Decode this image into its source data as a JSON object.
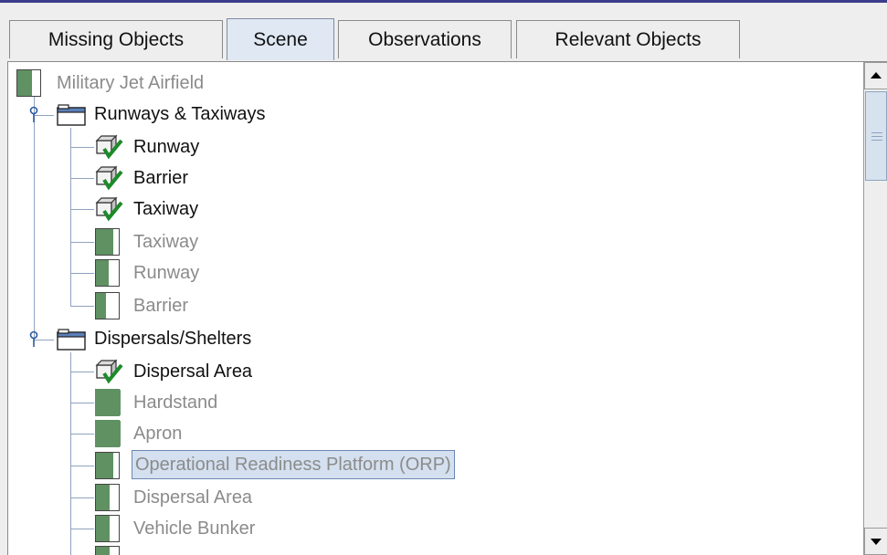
{
  "tabs": [
    {
      "label": "Missing Objects",
      "selected": false
    },
    {
      "label": "Scene",
      "selected": true
    },
    {
      "label": "Observations",
      "selected": false
    },
    {
      "label": "Relevant Objects",
      "selected": false
    }
  ],
  "tree": {
    "root": {
      "label": "Military Jet Airfield",
      "icon": "status-box-icon",
      "fill": 0.6
    },
    "groups": [
      {
        "label": "Runways & Taxiways",
        "icon": "folder-icon",
        "children": [
          {
            "label": "Runway",
            "icon": "check-box-icon"
          },
          {
            "label": "Barrier",
            "icon": "check-box-icon"
          },
          {
            "label": "Taxiway",
            "icon": "check-box-icon"
          },
          {
            "label": "Taxiway",
            "icon": "status-box-icon",
            "fill": 0.7
          },
          {
            "label": "Runway",
            "icon": "status-box-icon",
            "fill": 0.5
          },
          {
            "label": "Barrier",
            "icon": "status-box-icon",
            "fill": 0.4
          }
        ]
      },
      {
        "label": "Dispersals/Shelters",
        "icon": "folder-icon",
        "children": [
          {
            "label": "Dispersal Area",
            "icon": "check-box-icon"
          },
          {
            "label": "Hardstand",
            "icon": "status-box-icon",
            "fill": 1.0
          },
          {
            "label": "Apron",
            "icon": "status-box-icon",
            "fill": 1.0
          },
          {
            "label": "Operational Readiness Platform (ORP)",
            "icon": "status-box-icon",
            "fill": 0.7,
            "selected": true
          },
          {
            "label": "Dispersal Area",
            "icon": "status-box-icon",
            "fill": 0.55
          },
          {
            "label": "Vehicle Bunker",
            "icon": "status-box-icon",
            "fill": 0.55
          }
        ]
      }
    ]
  },
  "colors": {
    "status_fill": "#5f9162",
    "check": "#1c8a2a",
    "selection": "#d4e0ef"
  }
}
